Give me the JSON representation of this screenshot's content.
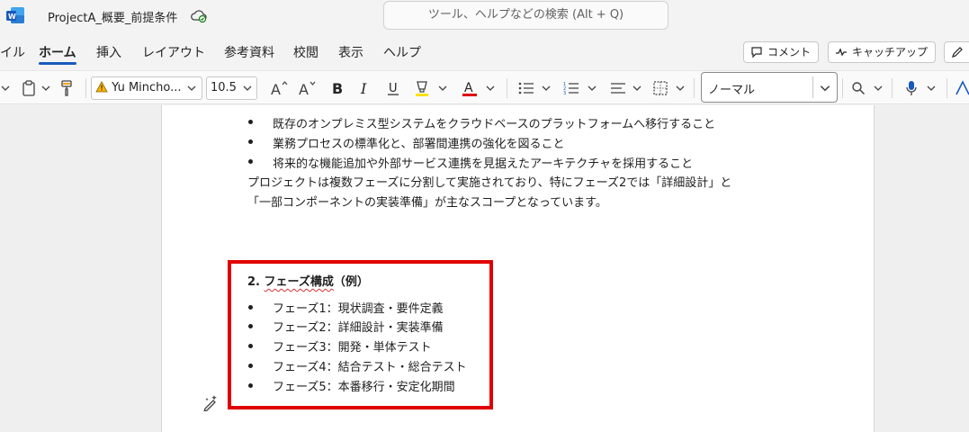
{
  "titlebar": {
    "doc_title": "ProjectA_概要_前提条件",
    "search_placeholder": "ツール、ヘルプなどの検索 (Alt + Q)"
  },
  "tabs": [
    {
      "label": "イル"
    },
    {
      "label": "ホーム",
      "active": true
    },
    {
      "label": "挿入"
    },
    {
      "label": "レイアウト"
    },
    {
      "label": "参考資料"
    },
    {
      "label": "校閲"
    },
    {
      "label": "表示"
    },
    {
      "label": "ヘルプ"
    }
  ],
  "actions": {
    "comment_label": "コメント",
    "catchup_label": "キャッチアップ"
  },
  "ribbon": {
    "font_name": "Yu Mincho...",
    "font_size": "10.5",
    "style_name": "ノーマル",
    "font_color": "#e00000",
    "highlight_color": "#ffe100"
  },
  "document": {
    "bullets_top": [
      "既存のオンプレミス型システムをクラウドベースのプラットフォームへ移行すること",
      "業務プロセスの標準化と、部署間連携の強化を図ること",
      "将来的な機能追加や外部サービス連携を見据えたアーキテクチャを採用すること"
    ],
    "para_line1": "プロジェクトは複数フェーズに分割して実施されており、特にフェーズ2では「詳細設計」と",
    "para_line2": "「一部コンポーネントの実装準備」が主なスコープとなっています。",
    "section_number": "2.",
    "section_title": "フェーズ構成",
    "section_suffix": "（例）",
    "phases": [
      "フェーズ1：現状調査・要件定義",
      "フェーズ2：詳細設計・実装準備",
      "フェーズ3：開発・単体テスト",
      "フェーズ4：結合テスト・総合テスト",
      "フェーズ5：本番移行・安定化期間"
    ]
  }
}
